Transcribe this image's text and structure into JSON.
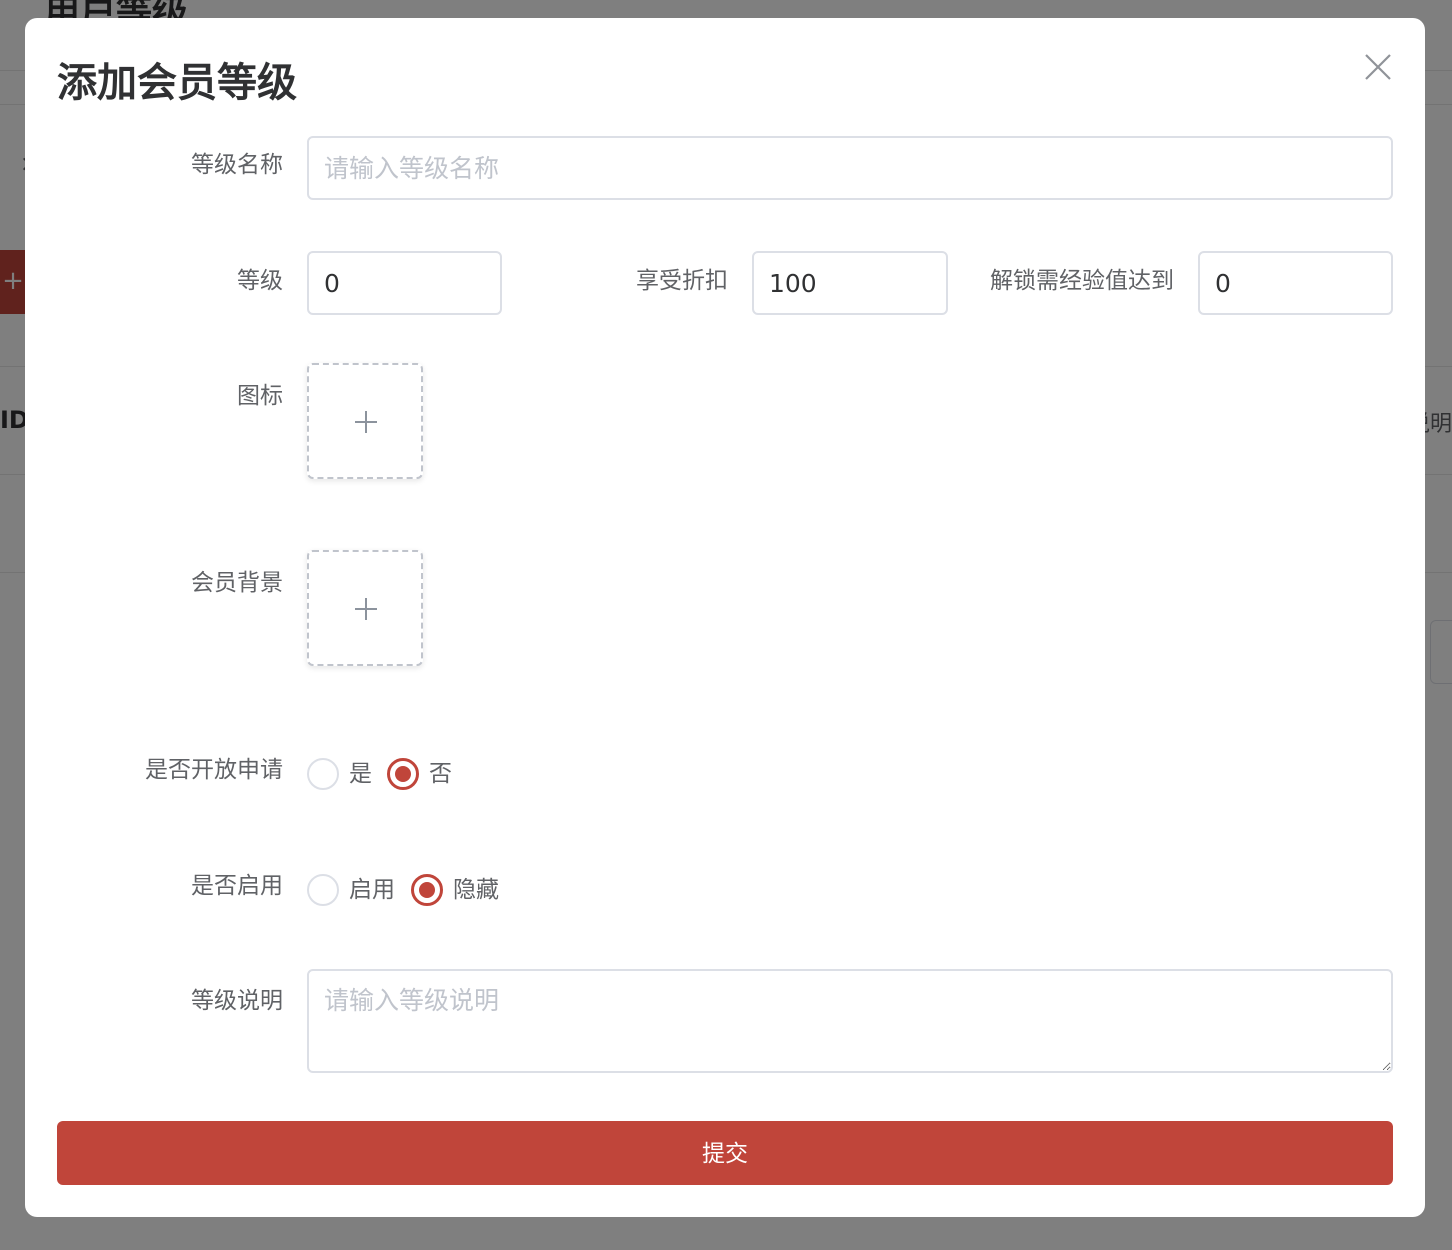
{
  "background": {
    "page_title": "用户等级",
    "column_id": "ID",
    "column_desc": "说明",
    "add_icon": "plus-icon",
    "close_icon": "close-icon"
  },
  "dialog": {
    "title": "添加会员等级",
    "close_icon": "close-icon",
    "fields": {
      "name": {
        "label": "等级名称",
        "placeholder": "请输入等级名称",
        "value": ""
      },
      "level": {
        "label": "等级",
        "value": "0"
      },
      "discount": {
        "label": "享受折扣",
        "value": "100"
      },
      "exp": {
        "label": "解锁需经验值达到",
        "value": "0"
      },
      "icon": {
        "label": "图标",
        "upload_icon": "plus-icon"
      },
      "background": {
        "label": "会员背景",
        "upload_icon": "plus-icon"
      },
      "open_apply": {
        "label": "是否开放申请",
        "options": [
          "是",
          "否"
        ],
        "selected": "否"
      },
      "enabled": {
        "label": "是否启用",
        "options": [
          "启用",
          "隐藏"
        ],
        "selected": "隐藏"
      },
      "description": {
        "label": "等级说明",
        "placeholder": "请输入等级说明",
        "value": ""
      }
    },
    "submit_label": "提交"
  },
  "colors": {
    "primary": "#c0453a",
    "overlay": "rgba(0,0,0,0.5)",
    "label_text": "#606266",
    "placeholder": "#c0c4cc",
    "border": "#dcdfe6"
  }
}
